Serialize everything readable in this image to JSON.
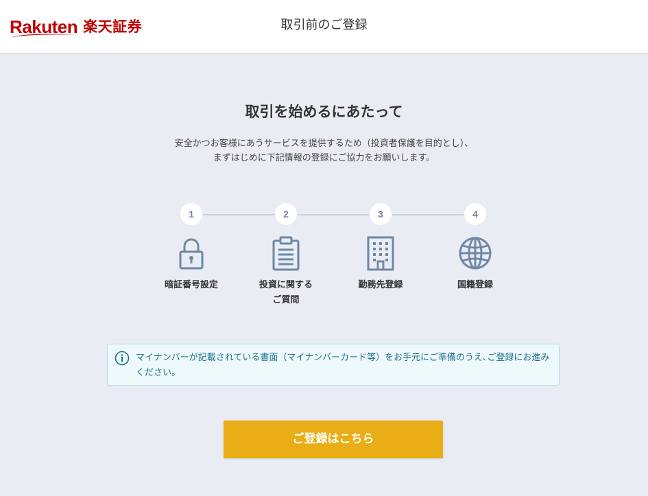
{
  "header": {
    "logo_latin": "Rakuten",
    "logo_jp": "楽天証券",
    "title": "取引前のご登録"
  },
  "main": {
    "title": "取引を始めるにあたって",
    "intro_line1": "安全かつお客様にあうサービスを提供するため（投資者保護を目的とし）、",
    "intro_line2": "まずはじめに下記情報の登録にご協力をお願いします。"
  },
  "steps": [
    {
      "number": "1",
      "icon": "lock-icon",
      "label_line1": "暗証番号設定",
      "label_line2": ""
    },
    {
      "number": "2",
      "icon": "clipboard-icon",
      "label_line1": "投資に関する",
      "label_line2": "ご質問"
    },
    {
      "number": "3",
      "icon": "building-icon",
      "label_line1": "勤務先登録",
      "label_line2": ""
    },
    {
      "number": "4",
      "icon": "globe-icon",
      "label_line1": "国籍登録",
      "label_line2": ""
    }
  ],
  "notice": {
    "icon": "info-icon",
    "text": "マイナンバーが記載されている書面（マイナンバーカード等）をお手元にご準備のうえ､ご登録にお進みください。"
  },
  "cta": {
    "label": "ご登録はこちら"
  },
  "colors": {
    "brand": "#bf0000",
    "background": "#e9edf3",
    "step_icon": "#6f87a6",
    "notice_text": "#1e6f8c",
    "notice_border": "#a9dcea",
    "cta": "#e9ad15"
  }
}
